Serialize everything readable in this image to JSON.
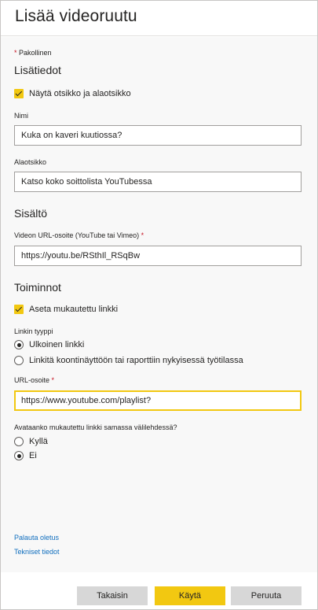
{
  "dialog": {
    "title": "Lisää videoruutu",
    "required_star": "*",
    "required_note": "Pakollinen"
  },
  "details": {
    "heading": "Lisätiedot",
    "show_title_label": "Näytä otsikko ja alaotsikko",
    "show_title_checked": true,
    "name_label": "Nimi",
    "name_value": "Kuka on kaveri kuutiossa?",
    "subtitle_label": "Alaotsikko",
    "subtitle_value": "Katso koko soittolista YouTubessa"
  },
  "content": {
    "heading": "Sisältö",
    "video_url_label": "Videon URL-osoite (YouTube tai Vimeo)",
    "video_url_star": "*",
    "video_url_value": "https://youtu.be/RSthIl_RSqBw"
  },
  "actions": {
    "heading": "Toiminnot",
    "custom_link_label": "Aseta mukautettu linkki",
    "custom_link_checked": true,
    "link_type_label": "Linkin tyyppi",
    "link_type_options": [
      {
        "label": "Ulkoinen linkki",
        "selected": true
      },
      {
        "label": "Linkitä koontinäyttöön tai raporttiin nykyisessä työtilassa",
        "selected": false
      }
    ],
    "url_label": "URL-osoite",
    "url_star": "*",
    "url_value": "https://www.youtube.com/playlist?",
    "open_same_tab_label": "Avataanko mukautettu linkki samassa välilehdessä?",
    "open_same_tab_options": [
      {
        "label": "Kyllä",
        "selected": false
      },
      {
        "label": "Ei",
        "selected": true
      }
    ]
  },
  "links": {
    "restore_default": "Palauta oletus",
    "technical_details": "Tekniset tiedot"
  },
  "buttons": {
    "back": "Takaisin",
    "apply": "Käytä",
    "cancel": "Peruuta"
  },
  "colors": {
    "accent": "#F2C811",
    "link": "#106EBE",
    "required": "#C50F1F"
  }
}
